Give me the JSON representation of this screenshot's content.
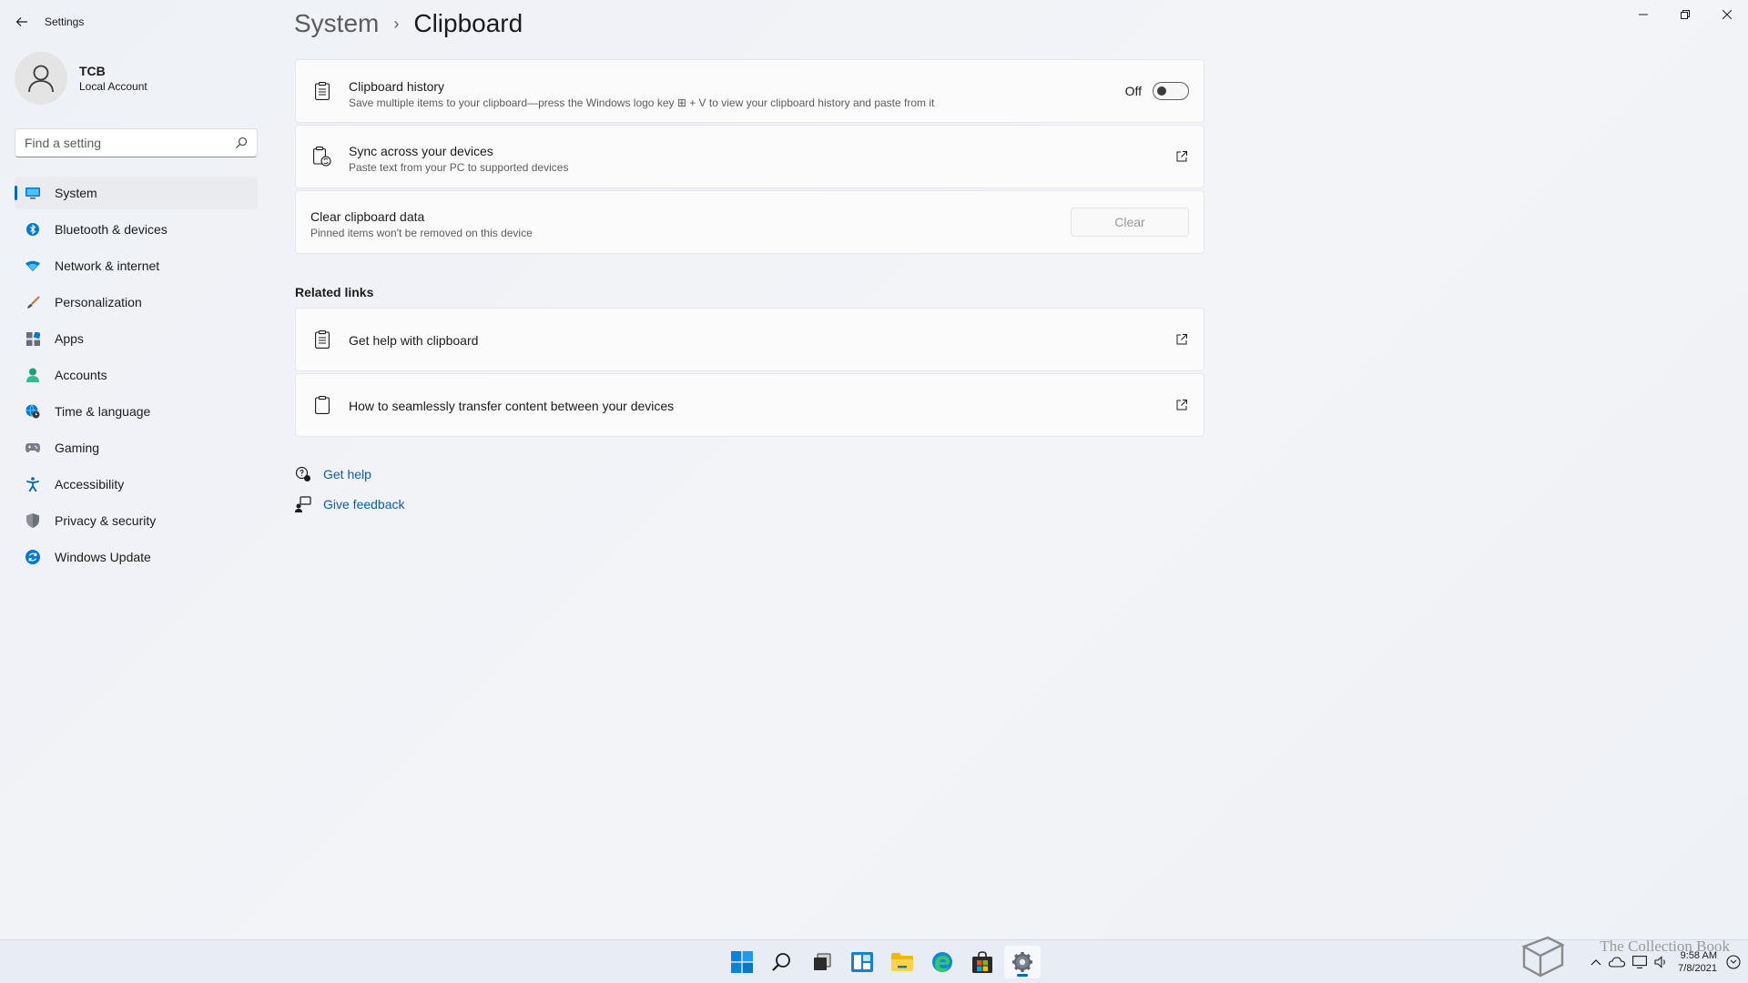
{
  "window": {
    "app_title": "Settings"
  },
  "profile": {
    "name": "TCB",
    "account_type": "Local Account"
  },
  "search": {
    "placeholder": "Find a setting"
  },
  "sidebar": {
    "items": [
      {
        "label": "System",
        "icon": "system-monitor-icon",
        "active": true
      },
      {
        "label": "Bluetooth & devices",
        "icon": "bluetooth-icon"
      },
      {
        "label": "Network & internet",
        "icon": "wifi-icon"
      },
      {
        "label": "Personalization",
        "icon": "brush-icon"
      },
      {
        "label": "Apps",
        "icon": "apps-icon"
      },
      {
        "label": "Accounts",
        "icon": "person-icon"
      },
      {
        "label": "Time & language",
        "icon": "globe-clock-icon"
      },
      {
        "label": "Gaming",
        "icon": "gamepad-icon"
      },
      {
        "label": "Accessibility",
        "icon": "accessibility-icon"
      },
      {
        "label": "Privacy & security",
        "icon": "shield-icon"
      },
      {
        "label": "Windows Update",
        "icon": "update-icon"
      }
    ]
  },
  "breadcrumb": {
    "parent": "System",
    "separator": "›",
    "current": "Clipboard"
  },
  "settings": {
    "history": {
      "title": "Clipboard history",
      "description": "Save multiple items to your clipboard—press the Windows logo key ⊞ + V to view your clipboard history and paste from it",
      "state": "Off"
    },
    "sync": {
      "title": "Sync across your devices",
      "description": "Paste text from your PC to supported devices"
    },
    "clear": {
      "title": "Clear clipboard data",
      "description": "Pinned items won't be removed on this device",
      "button": "Clear"
    }
  },
  "related": {
    "heading": "Related links",
    "links": [
      {
        "label": "Get help with clipboard"
      },
      {
        "label": "How to seamlessly transfer content between your devices"
      }
    ]
  },
  "help": {
    "get_help": "Get help",
    "give_feedback": "Give feedback"
  },
  "taskbar": {
    "apps": [
      "start-icon",
      "search-icon",
      "task-view-icon",
      "widgets-icon",
      "file-explorer-icon",
      "edge-icon",
      "store-icon",
      "settings-icon"
    ],
    "time": "9:58 AM",
    "date": "7/8/2021"
  },
  "watermark": "The Collection Book",
  "colors": {
    "accent": "#0067c0",
    "link": "#0a5fb4"
  }
}
